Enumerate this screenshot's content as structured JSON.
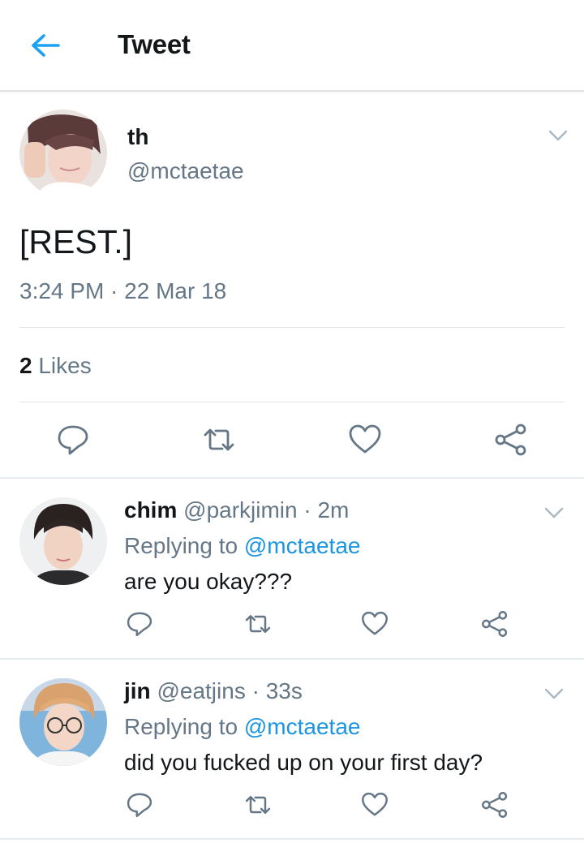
{
  "header": {
    "title": "Tweet",
    "back_icon": "arrow-left-icon",
    "accent": "#1da1f2"
  },
  "tweet": {
    "name": "th",
    "handle": "@mctaetae",
    "text": "[REST.]",
    "timestamp": "3:24 PM · 22 Mar 18",
    "likes_count": "2",
    "likes_label": "Likes"
  },
  "replies": [
    {
      "name": "chim",
      "handle": "@parkjimin",
      "sep": " · ",
      "time": "2m",
      "replying_prefix": "Replying to ",
      "replying_to": "@mctaetae",
      "text": "are you okay???"
    },
    {
      "name": "jin",
      "handle": "@eatjins",
      "sep": " · ",
      "time": "33s",
      "replying_prefix": "Replying to ",
      "replying_to": "@mctaetae",
      "text": "did you fucked up on your first day?"
    }
  ],
  "colors": {
    "text": "#14171a",
    "secondary": "#657786",
    "link": "#1b95e0",
    "divider": "#e6ecf0"
  }
}
